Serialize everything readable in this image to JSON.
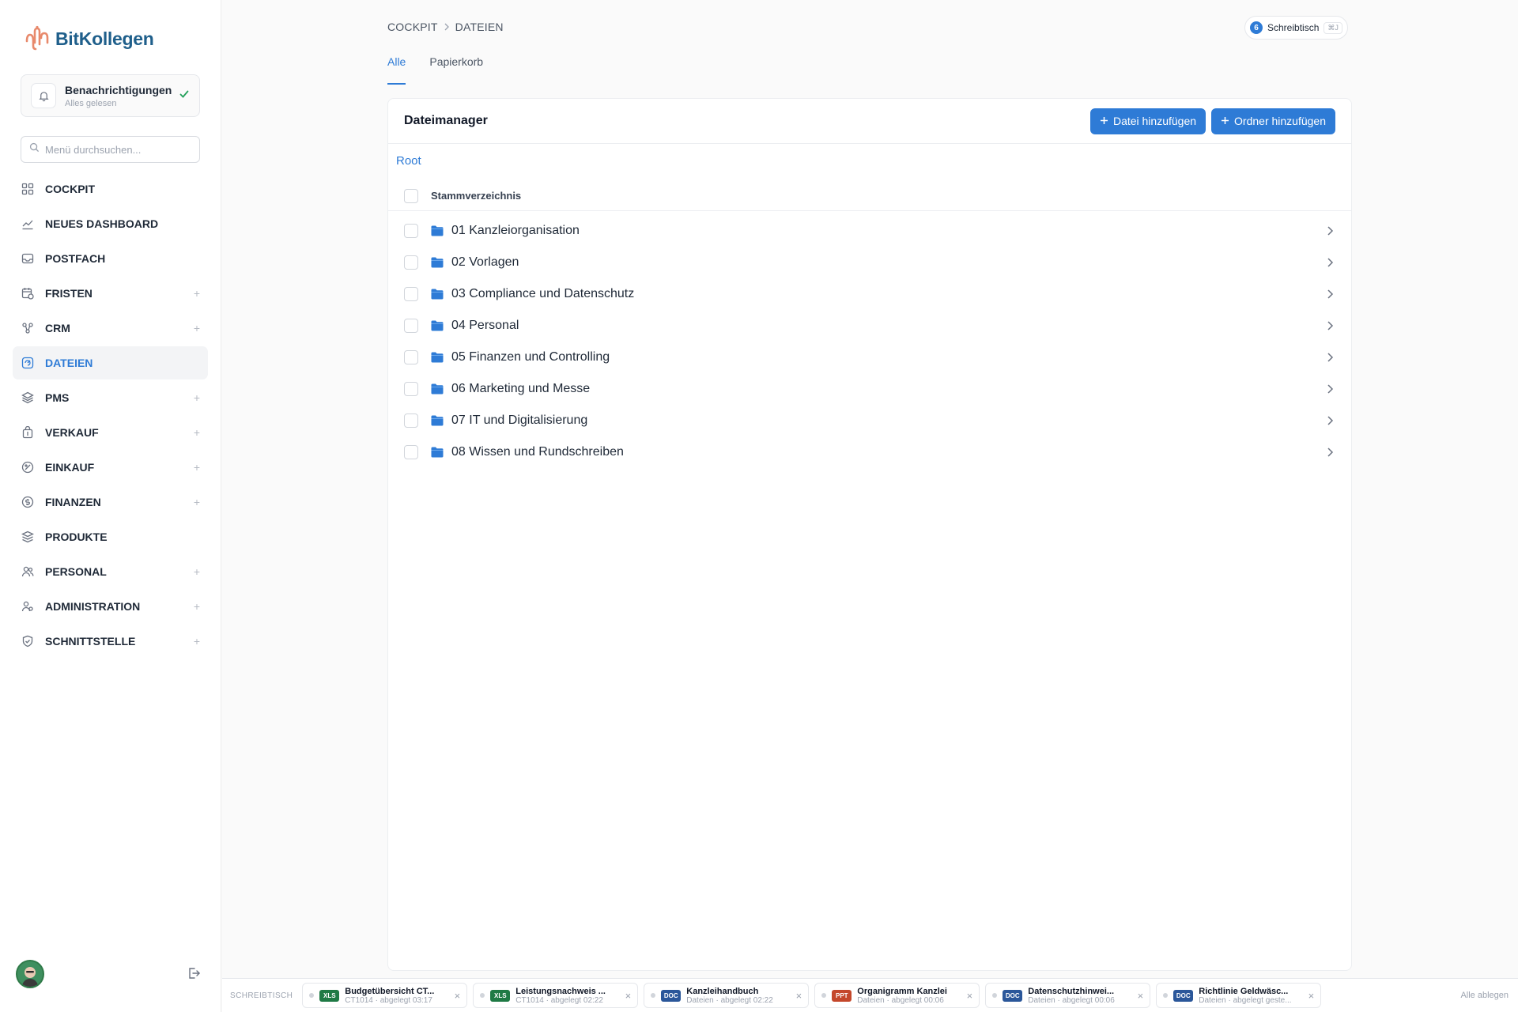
{
  "brand": {
    "name": "BitKollegen"
  },
  "notifications": {
    "title": "Benachrichtigungen",
    "subtitle": "Alles gelesen"
  },
  "sidebar": {
    "search_placeholder": "Menü durchsuchen...",
    "items": [
      {
        "label": "COCKPIT",
        "icon": "grid-icon",
        "expandable": false,
        "active": false
      },
      {
        "label": "NEUES DASHBOARD",
        "icon": "chart-line-icon",
        "expandable": false,
        "active": false
      },
      {
        "label": "POSTFACH",
        "icon": "inbox-icon",
        "expandable": false,
        "active": false
      },
      {
        "label": "FRISTEN",
        "icon": "calendar-clock-icon",
        "expandable": true,
        "active": false
      },
      {
        "label": "CRM",
        "icon": "network-icon",
        "expandable": true,
        "active": false
      },
      {
        "label": "DATEIEN",
        "icon": "files-icon",
        "expandable": false,
        "active": true
      },
      {
        "label": "PMS",
        "icon": "layers-icon",
        "expandable": true,
        "active": false
      },
      {
        "label": "VERKAUF",
        "icon": "bag-icon",
        "expandable": true,
        "active": false
      },
      {
        "label": "EINKAUF",
        "icon": "tag-icon",
        "expandable": true,
        "active": false
      },
      {
        "label": "FINANZEN",
        "icon": "coin-icon",
        "expandable": true,
        "active": false
      },
      {
        "label": "PRODUKTE",
        "icon": "stack-icon",
        "expandable": false,
        "active": false
      },
      {
        "label": "PERSONAL",
        "icon": "users-icon",
        "expandable": true,
        "active": false
      },
      {
        "label": "ADMINISTRATION",
        "icon": "user-gear-icon",
        "expandable": true,
        "active": false
      },
      {
        "label": "SCHNITTSTELLE",
        "icon": "shield-check-icon",
        "expandable": true,
        "active": false
      }
    ]
  },
  "breadcrumb": [
    "COCKPIT",
    "DATEIEN"
  ],
  "desk": {
    "count": "6",
    "label": "Schreibtisch",
    "shortcut": "⌘J"
  },
  "tabs": [
    {
      "label": "Alle",
      "active": true
    },
    {
      "label": "Papierkorb",
      "active": false
    }
  ],
  "file_manager": {
    "title": "Dateimanager",
    "add_file": "Datei hinzufügen",
    "add_folder": "Ordner hinzufügen",
    "path_root": "Root",
    "header_label": "Stammverzeichnis",
    "folders": [
      "01 Kanzleiorganisation",
      "02 Vorlagen",
      "03 Compliance und Datenschutz",
      "04 Personal",
      "05 Finanzen und Controlling",
      "06 Marketing und Messe",
      "07 IT und Digitalisierung",
      "08 Wissen und Rundschreiben"
    ]
  },
  "footer": {
    "label": "SCHREIBTISCH",
    "action": "Alle ablegen",
    "docs": [
      {
        "type": "XLS",
        "color": "#1f7a45",
        "title": "Budgetübersicht CT...",
        "sub": "CT1014 · abgelegt 03:17"
      },
      {
        "type": "XLS",
        "color": "#1f7a45",
        "title": "Leistungsnachweis ...",
        "sub": "CT1014 · abgelegt 02:22"
      },
      {
        "type": "DOC",
        "color": "#2b579a",
        "title": "Kanzleihandbuch",
        "sub": "Dateien · abgelegt 02:22"
      },
      {
        "type": "PPT",
        "color": "#c4472b",
        "title": "Organigramm Kanzlei",
        "sub": "Dateien · abgelegt 00:06"
      },
      {
        "type": "DOC",
        "color": "#2b579a",
        "title": "Datenschutzhinwei...",
        "sub": "Dateien · abgelegt 00:06"
      },
      {
        "type": "DOC",
        "color": "#2b579a",
        "title": "Richtlinie Geldwäsc...",
        "sub": "Dateien · abgelegt geste..."
      }
    ]
  },
  "colors": {
    "accent": "#2e7bd6",
    "brand": "#1f5f8b",
    "logo_accent": "#e8896b"
  }
}
